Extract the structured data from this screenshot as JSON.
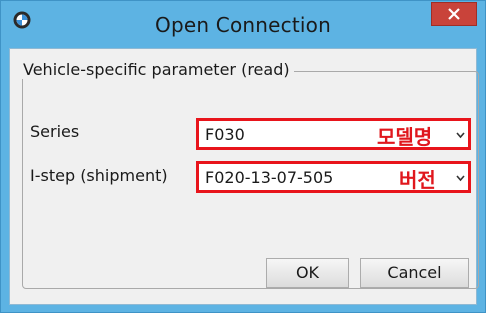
{
  "window": {
    "title": "Open Connection"
  },
  "group": {
    "title": "Vehicle-specific parameter (read)"
  },
  "fields": {
    "series": {
      "label": "Series",
      "value": "F030",
      "annotation": "모델명"
    },
    "istep": {
      "label": "I-step (shipment)",
      "value": "F020-13-07-505",
      "annotation": "버전"
    }
  },
  "buttons": {
    "ok": "OK",
    "cancel": "Cancel"
  },
  "icons": {
    "app": "bmw-logo-icon",
    "close": "close-icon",
    "dropdown": "chevron-down-icon"
  },
  "colors": {
    "titlebar": "#5db3e3",
    "close_button": "#c9433a",
    "highlight": "#e8141b"
  }
}
